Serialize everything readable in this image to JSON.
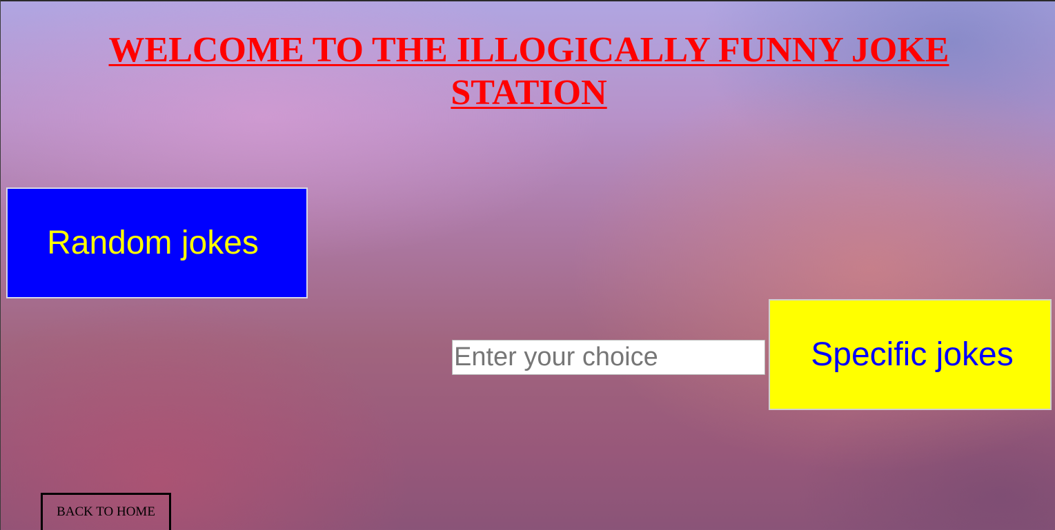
{
  "header": {
    "title": "WELCOME TO THE ILLOGICALLY FUNNY JOKE STATION"
  },
  "random_button": {
    "label": "Random jokes"
  },
  "search": {
    "placeholder": "Enter your choice",
    "value": ""
  },
  "specific_button": {
    "label": "Specific jokes"
  },
  "back_button": {
    "label": "BACK TO HOME"
  },
  "colors": {
    "title": "#ff0000",
    "random_bg": "#0000ff",
    "random_text": "#ffff00",
    "specific_bg": "#ffff00",
    "specific_text": "#0000ff",
    "back_border": "#000000"
  }
}
